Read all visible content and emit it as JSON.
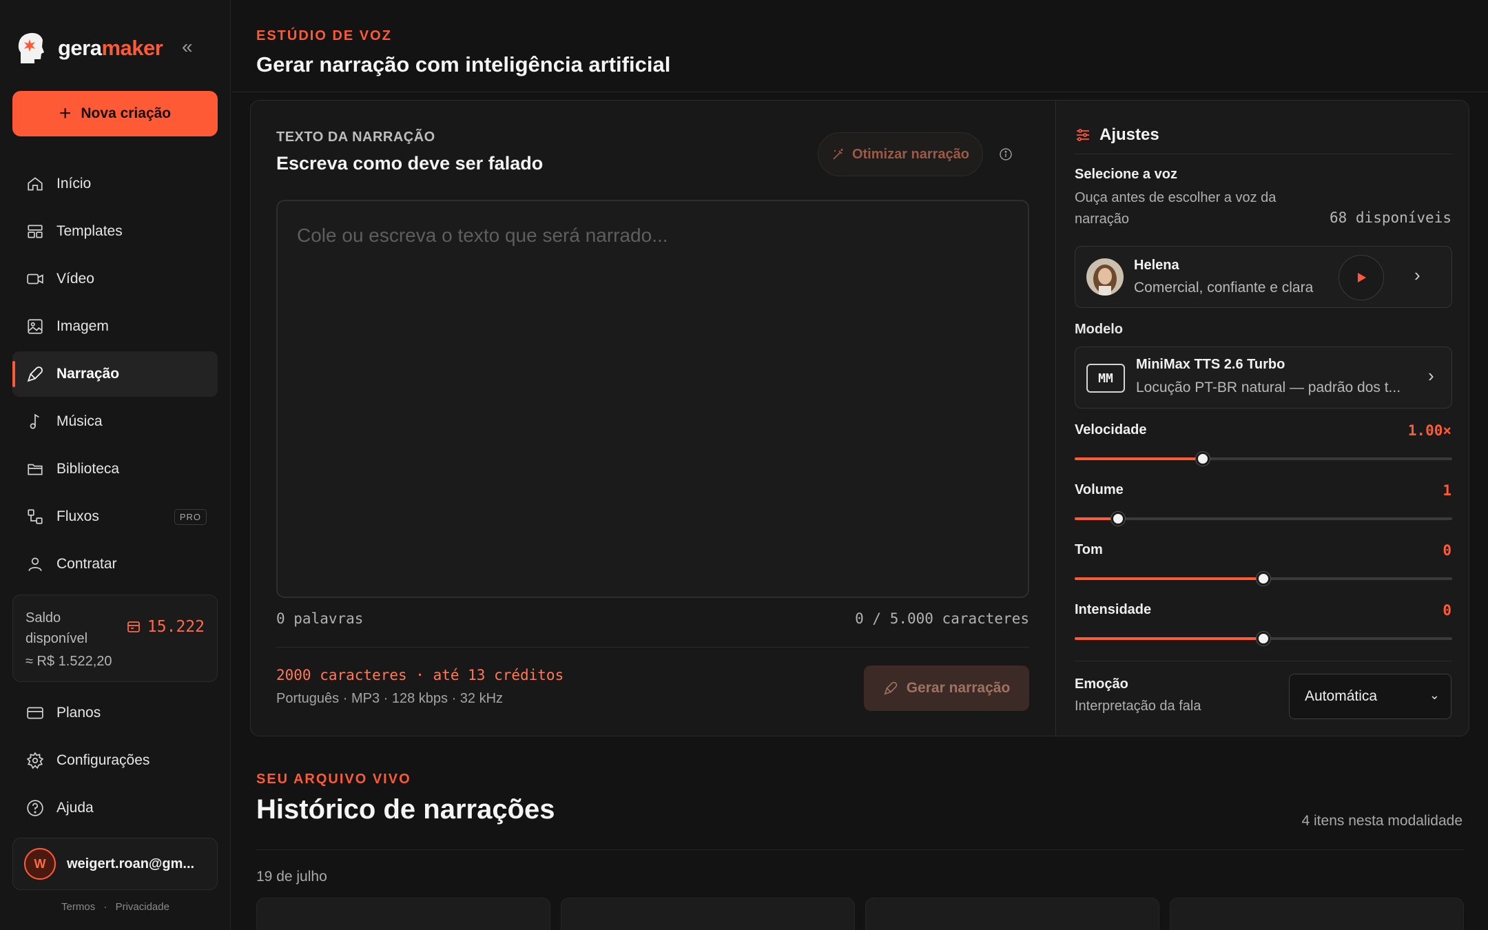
{
  "brand": {
    "name_part1": "gera",
    "name_part2": "maker",
    "accent": "#ff5a36"
  },
  "sidebar": {
    "collapse_icon": "double-chevron-left-icon",
    "new_button": "Nova criação",
    "items": [
      {
        "label": "Início",
        "icon": "home-icon"
      },
      {
        "label": "Templates",
        "icon": "templates-icon"
      },
      {
        "label": "Vídeo",
        "icon": "video-icon"
      },
      {
        "label": "Imagem",
        "icon": "image-icon"
      },
      {
        "label": "Narração",
        "icon": "microphone-icon",
        "active": true
      },
      {
        "label": "Música",
        "icon": "music-icon"
      },
      {
        "label": "Biblioteca",
        "icon": "folder-icon"
      },
      {
        "label": "Fluxos",
        "icon": "flows-icon",
        "badge": "PRO"
      },
      {
        "label": "Contratar",
        "icon": "user-icon"
      }
    ],
    "balance": {
      "label": "Saldo disponível",
      "credits": "15.222",
      "money": "≈ R$ 1.522,20"
    },
    "bottom_items": [
      {
        "label": "Planos",
        "icon": "card-icon"
      },
      {
        "label": "Configurações",
        "icon": "gear-icon"
      },
      {
        "label": "Ajuda",
        "icon": "help-icon"
      }
    ],
    "user": {
      "initial": "W",
      "email": "weigert.roan@gm..."
    },
    "footer": {
      "terms": "Termos",
      "privacy": "Privacidade",
      "separator": "·"
    }
  },
  "header": {
    "eyebrow": "ESTÚDIO DE VOZ",
    "title": "Gerar narração com inteligência artificial"
  },
  "editor": {
    "section_label": "TEXTO DA NARRAÇÃO",
    "section_title": "Escreva como deve ser falado",
    "optimize_button": "Otimizar narração",
    "placeholder": "Cole ou escreva o texto que será narrado...",
    "word_count": "0 palavras",
    "char_count": "0 / 5.000 caracteres",
    "cost": "2000 caracteres · até 13 créditos",
    "format": "Português · MP3 · 128 kbps · 32 kHz",
    "generate_button": "Gerar narração"
  },
  "settings": {
    "title": "Ajustes",
    "voice_title": "Selecione a voz",
    "voice_desc": "Ouça antes de escolher a voz da narração",
    "voice_count": "68 disponíveis",
    "voice": {
      "name": "Helena",
      "desc": "Comercial, confiante e clara"
    },
    "model_title": "Modelo",
    "model": {
      "badge": "MM",
      "name": "MiniMax TTS 2.6 Turbo",
      "desc": "Locução PT-BR natural — padrão dos t..."
    },
    "sliders": [
      {
        "label": "Velocidade",
        "value": "1.00×",
        "fraction": 0.34
      },
      {
        "label": "Volume",
        "value": "1",
        "fraction": 0.115
      },
      {
        "label": "Tom",
        "value": "0",
        "fraction": 0.5
      },
      {
        "label": "Intensidade",
        "value": "0",
        "fraction": 0.5
      }
    ],
    "emotion": {
      "title": "Emoção",
      "subtitle": "Interpretação da fala",
      "selected": "Automática"
    }
  },
  "history": {
    "eyebrow": "SEU ARQUIVO VIVO",
    "title": "Histórico de narrações",
    "count": "4 itens nesta modalidade",
    "date": "19 de julho"
  }
}
